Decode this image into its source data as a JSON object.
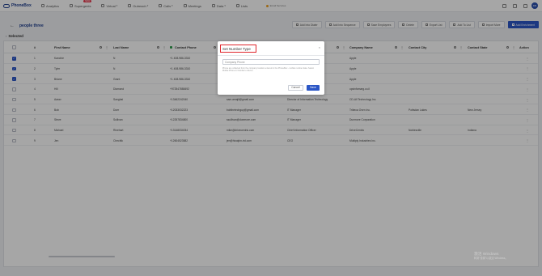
{
  "topbar": {
    "logo": "PhoneBox",
    "nav": [
      {
        "label": "Analytics",
        "icon": "chart-icon"
      },
      {
        "label": "Supergents",
        "icon": "agent-icon",
        "badge": "NEW"
      },
      {
        "label": "Virtual",
        "icon": "virtual-icon",
        "caret": "▾"
      },
      {
        "label": "Outreach",
        "icon": "outreach-icon",
        "caret": "▾"
      },
      {
        "label": "Calls",
        "icon": "phone-icon",
        "caret": "▾"
      },
      {
        "label": "Meetings",
        "icon": "calendar-icon"
      },
      {
        "label": "Data",
        "icon": "data-icon",
        "caret": "▾"
      },
      {
        "label": "Lists",
        "icon": "list-icon"
      }
    ],
    "email_warning": "Email Services",
    "avatar": "DM"
  },
  "list": {
    "back": "←",
    "title": "people three",
    "actions": [
      {
        "label": "Add Into Dialer",
        "icon": "dialer-icon",
        "primary": false
      },
      {
        "label": "Add Into Sequence",
        "icon": "sequence-icon",
        "primary": false
      },
      {
        "label": "Save Employees",
        "icon": "save-icon",
        "primary": false
      },
      {
        "label": "Delete",
        "icon": "trash-icon",
        "primary": false
      },
      {
        "label": "Export List",
        "icon": "export-icon",
        "primary": false
      },
      {
        "label": "Add To List",
        "icon": "add-list-icon",
        "primary": false
      },
      {
        "label": "Import More",
        "icon": "import-icon",
        "primary": false
      },
      {
        "label": "Add Enrichment",
        "icon": "enrich-icon",
        "primary": true
      }
    ],
    "selected_label": "Selected",
    "selected_icon": "›"
  },
  "table": {
    "columns": [
      "#",
      "First Name",
      "Last Name",
      "Contact Phone",
      "Email",
      "Job Title",
      "Company Name",
      "Contact City",
      "Contact State",
      "Action"
    ],
    "rows": [
      {
        "checked": true,
        "num": "1",
        "first": "Kanchie",
        "last": "N",
        "phone": "+1 408-986-3310",
        "email": "",
        "title": "",
        "company": "Apple",
        "city": "",
        "state": ""
      },
      {
        "checked": true,
        "num": "2",
        "first": "Tyler",
        "last": "N",
        "phone": "+1 408-986-3310",
        "email": "",
        "title": "",
        "company": "Apple",
        "city": "",
        "state": ""
      },
      {
        "checked": true,
        "num": "3",
        "first": "Briane",
        "last": "Grant",
        "phone": "+1 408-986-3310",
        "email": "",
        "title": "",
        "company": "Apple",
        "city": "",
        "state": ""
      },
      {
        "checked": false,
        "num": "4",
        "first": "Hill",
        "last": "Diamond",
        "phone": "+972547888492",
        "email": "",
        "title": "",
        "company": "opsinfomarg.co.il",
        "city": "",
        "state": ""
      },
      {
        "checked": false,
        "num": "5",
        "first": "Aarav",
        "last": "Sanghai",
        "phone": "+13462242040",
        "email": "sam.amajil@gmail.com",
        "title": "Director of Information Technology",
        "company": "CD-All Technology Inc.",
        "city": "",
        "state": ""
      },
      {
        "checked": false,
        "num": "6",
        "first": "Bob",
        "last": "Doer",
        "phone": "+12033032223",
        "email": "bobthetechguy@gmail.com",
        "title": "IT Manager",
        "company": "Tribeca Oven Inc.",
        "city": "Pottsdan Lakes",
        "state": "New Jersey"
      },
      {
        "checked": false,
        "num": "7",
        "first": "Steve",
        "last": "Sullivan",
        "phone": "+12257834800",
        "email": "ssullivan@dunmore.com",
        "title": "IT Manager",
        "company": "Dunmore Corporation",
        "city": "",
        "state": ""
      },
      {
        "checked": false,
        "num": "8",
        "first": "Michael",
        "last": "Rinehart",
        "phone": "+13148034034",
        "email": "mike@drivecentric.com",
        "title": "Chief Information Officer",
        "company": "DriveCentric",
        "city": "Noblesville",
        "state": "Indiana"
      },
      {
        "checked": false,
        "num": "9",
        "first": "Jen",
        "last": "Chechik",
        "phone": "+12604523582",
        "email": "jen@hicalpin-rtd.com",
        "title": "CEO",
        "company": "Multiply Industries Inc.",
        "city": "",
        "state": ""
      }
    ],
    "row_menu": "⋮"
  },
  "modal": {
    "title": "Set Number Type",
    "close": "×",
    "input_value": "Company Phone",
    "help_text": "Phone are collected from the company location entered in the PhoneBox - mobile number data. Select Mobile Phone in Numbers column.",
    "cancel_label": "Cancel",
    "save_label": "Save"
  },
  "watermark": {
    "line1": "激活 Windows",
    "line2": "转到\"设置\"以激活 Windows。"
  },
  "colors": {
    "brand": "#1f3f8f",
    "primary": "#2b56c6",
    "highlight": "#e0252b"
  }
}
